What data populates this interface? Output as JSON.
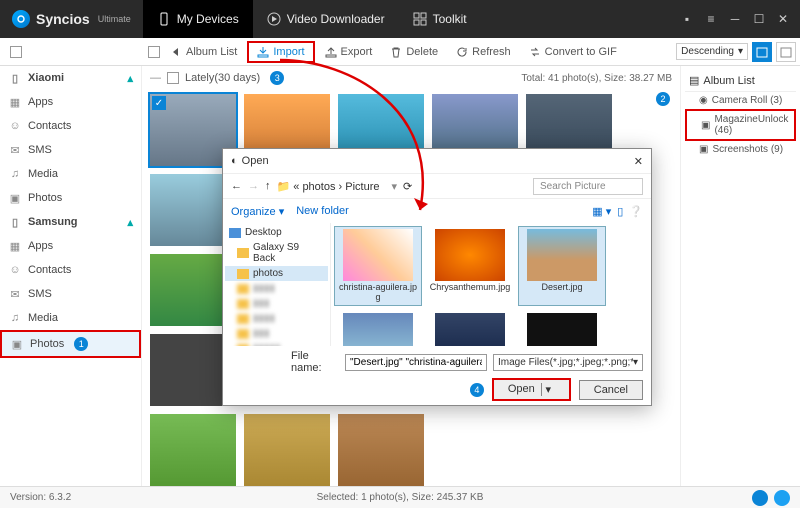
{
  "app": {
    "name": "Syncios",
    "edition": "Ultimate"
  },
  "topnav": {
    "devices": "My Devices",
    "downloader": "Video Downloader",
    "toolkit": "Toolkit"
  },
  "toolbar": {
    "back": "Album List",
    "import": "Import",
    "export": "Export",
    "delete": "Delete",
    "refresh": "Refresh",
    "convert": "Convert to GIF",
    "sort": "Descending"
  },
  "sidebar": {
    "dev1": "Xiaomi",
    "dev2": "Samsung",
    "items": [
      "Apps",
      "Contacts",
      "SMS",
      "Media",
      "Photos"
    ]
  },
  "subheader": {
    "group": "Lately(30 days)",
    "stats": "Total: 41 photo(s), Size: 38.27 MB"
  },
  "rightpane": {
    "title": "Album List",
    "items": [
      {
        "label": "Camera Roll (3)"
      },
      {
        "label": "MagazineUnlock (46)"
      },
      {
        "label": "Screenshots (9)"
      }
    ]
  },
  "dialog": {
    "title": "Open",
    "crumb1": "photos",
    "crumb2": "Picture",
    "search_ph": "Search Picture",
    "organize": "Organize",
    "newfolder": "New folder",
    "tree": {
      "desktop": "Desktop",
      "backup": "Galaxy S9 Back",
      "photos": "photos"
    },
    "files": [
      {
        "name": "christina-aguilera.jpg"
      },
      {
        "name": "Chrysanthemum.jpg"
      },
      {
        "name": "Desert.jpg"
      }
    ],
    "fn_label": "File name:",
    "fn_value": "\"Desert.jpg\" \"christina-aguilera.jpg\"",
    "filter": "Image Files(*.jpg;*.jpeg;*.png;*.",
    "open": "Open",
    "cancel": "Cancel"
  },
  "status": {
    "version": "Version: 6.3.2",
    "selection": "Selected: 1 photo(s), Size: 245.37 KB"
  },
  "badges": {
    "b1": "1",
    "b2": "2",
    "b3": "3",
    "b4": "4"
  }
}
